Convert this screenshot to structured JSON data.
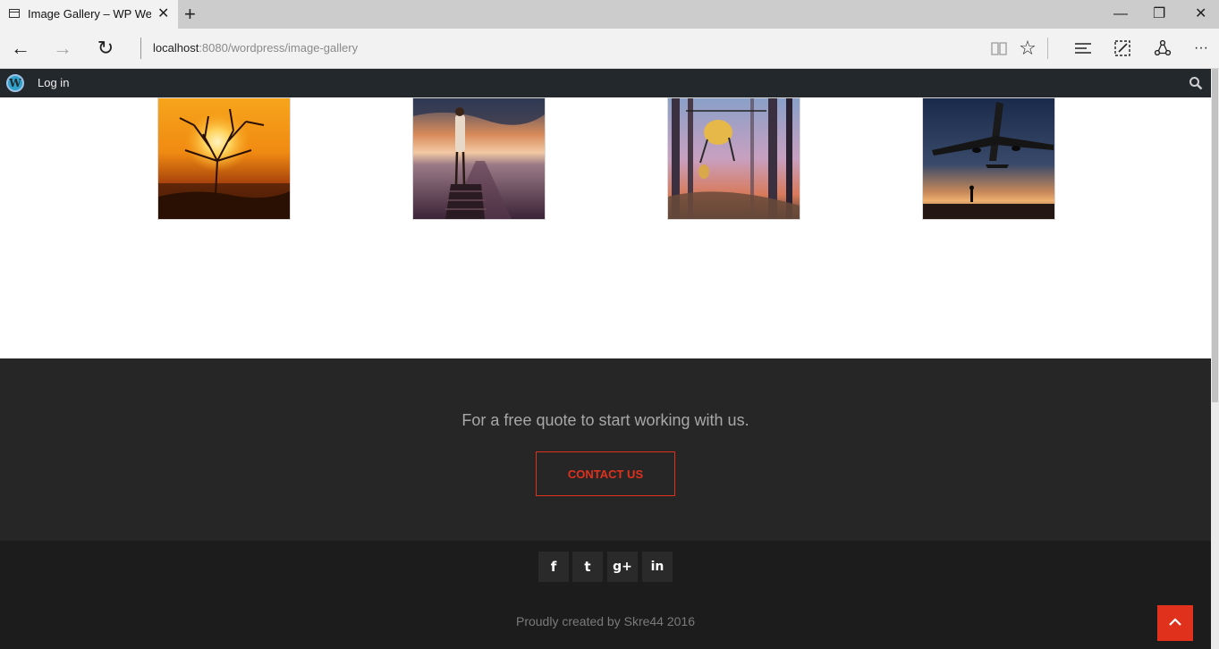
{
  "browser": {
    "tab_title": "Image Gallery – WP Wel",
    "tab_close": "✕",
    "new_tab": "+",
    "minimize": "—",
    "restore": "❐",
    "close": "✕",
    "address_host": "localhost",
    "address_rest": ":8080/wordpress/image-gallery",
    "back": "←",
    "forward": "→",
    "refresh": "↻",
    "more": "···",
    "favorite": "☆"
  },
  "adminbar": {
    "logo_letter": "W",
    "login": "Log in"
  },
  "gallery": {
    "images": [
      {
        "subject": "sunset-tree"
      },
      {
        "subject": "woman-on-pier"
      },
      {
        "subject": "helicopter-forest"
      },
      {
        "subject": "airplane-sky"
      }
    ]
  },
  "footer": {
    "cta_text": "For a free quote to start working with us.",
    "cta_button": "CONTACT US",
    "social": {
      "facebook": "f",
      "twitter": "t",
      "google_plus": "g+",
      "linkedin": "in"
    },
    "credit": "Proudly created by Skre44 2016"
  },
  "colors": {
    "accent": "#e0311d",
    "admin_bar": "#23282d",
    "cta_bg": "#262626",
    "footer_bg": "#1c1c1c"
  }
}
